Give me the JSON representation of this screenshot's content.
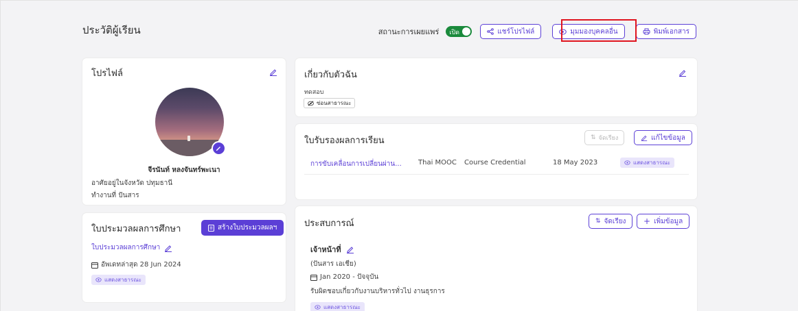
{
  "header": {
    "title": "ประวัติผู้เรียน",
    "public_status_label": "สถานะการเผยแพร่",
    "toggle_text": "เปิด",
    "share_label": "แชร์โปรไฟล์",
    "view_as_other_label": "มุมมองบุคคลอื่น",
    "print_label": "พิมพ์เอกสาร"
  },
  "profile": {
    "title": "โปรไฟล์",
    "name": "จีรนันท์ หลงจันทร์พะเนา",
    "lives_in": "อาศัยอยู่ในจังหวัด ปทุมธานี",
    "works_at": "ทำงานที่ ปันสาร"
  },
  "transcript": {
    "title": "ใบประมวลผลการศึกษา",
    "create_label": "สร้างใบประมวลผลฯ",
    "item_link": "ใบประมวลผลการศึกษา",
    "updated": "อัพเดทล่าสุด 28 Jun 2024",
    "public_tag": "แสดงสาธารณะ"
  },
  "about": {
    "title": "เกี่ยวกับตัวฉัน",
    "text": "ทดสอบ",
    "hidden_tag": "ซ่อนสาธารณะ"
  },
  "credentials": {
    "title": "ใบรับรองผลการเรียน",
    "sort_label": "จัดเรียง",
    "edit_label": "แก้ไขข้อมูล",
    "rows": [
      {
        "course": "การขับเคลื่อนการเปลี่ยนผ่าน...",
        "provider": "Thai MOOC",
        "type": "Course Credential",
        "date": "18 May 2023",
        "visibility": "แสดงสาธารณะ"
      }
    ]
  },
  "experience": {
    "title": "ประสบการณ์",
    "sort_label": "จัดเรียง",
    "add_label": "เพิ่มข้อมูล",
    "position": "เจ้าหน้าที่",
    "company": "(ปันสาร เอเชีย)",
    "period": "Jan 2020 - ปัจจุบัน",
    "description": "รับผิดชอบเกี่ยวกับงานบริหารทั่วไป งานธุรการ",
    "visibility": "แสดงสาธารณะ"
  },
  "colors": {
    "accent": "#5b3fd6",
    "toggle_on": "#1a8a3c",
    "highlight": "#e0141e"
  }
}
